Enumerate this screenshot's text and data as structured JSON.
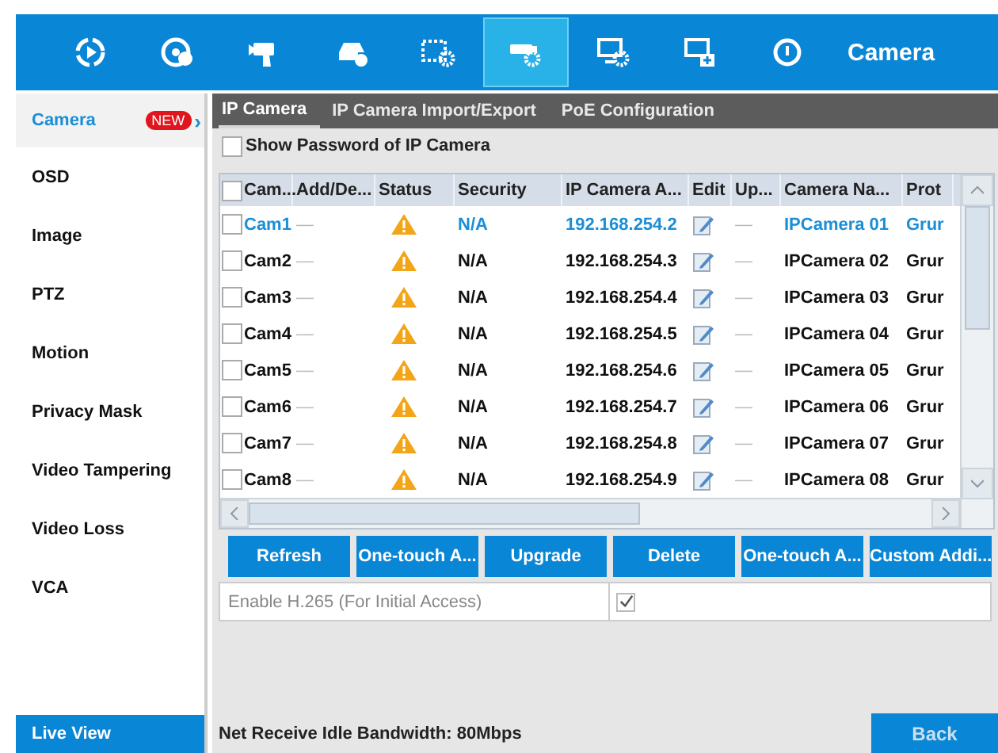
{
  "toolbar": {
    "items": [
      {
        "kind": "playback",
        "selected": false
      },
      {
        "kind": "disc",
        "selected": false
      },
      {
        "kind": "camera-hand",
        "selected": false
      },
      {
        "kind": "storage",
        "selected": false
      },
      {
        "kind": "film-gear",
        "selected": false
      },
      {
        "kind": "camera-gear",
        "selected": true
      },
      {
        "kind": "monitor-gear",
        "selected": false
      },
      {
        "kind": "monitor-plus",
        "selected": false
      },
      {
        "kind": "power",
        "selected": false
      }
    ],
    "title": "Camera"
  },
  "sidebar": {
    "items": [
      {
        "label": "Camera",
        "selected": true,
        "badge": "NEW",
        "arrow": "›"
      },
      {
        "label": "OSD",
        "selected": false
      },
      {
        "label": "Image",
        "selected": false
      },
      {
        "label": "PTZ",
        "selected": false
      },
      {
        "label": "Motion",
        "selected": false
      },
      {
        "label": "Privacy Mask",
        "selected": false
      },
      {
        "label": "Video Tampering",
        "selected": false
      },
      {
        "label": "Video Loss",
        "selected": false
      },
      {
        "label": "VCA",
        "selected": false
      }
    ],
    "footer": "Live View"
  },
  "tabs": [
    {
      "label": "IP Camera",
      "selected": true
    },
    {
      "label": "IP Camera Import/Export",
      "selected": false
    },
    {
      "label": "PoE Configuration",
      "selected": false
    }
  ],
  "show_password": {
    "label": "Show Password of IP Camera",
    "checked": false
  },
  "table": {
    "select_all": {
      "checked": false
    },
    "columns": [
      "Cam...",
      "Add/De...",
      "Status",
      "Security",
      "IP Camera A...",
      "Edit",
      "Up...",
      "Camera Na...",
      "Prot"
    ],
    "rows": [
      {
        "selected": true,
        "checked": false,
        "camera": "Cam1",
        "add": "—",
        "security": "N/A",
        "ip": "192.168.254.2",
        "upgrade": "—",
        "name": "IPCamera 01",
        "protocol": "Grur"
      },
      {
        "selected": false,
        "checked": false,
        "camera": "Cam2",
        "add": "—",
        "security": "N/A",
        "ip": "192.168.254.3",
        "upgrade": "—",
        "name": "IPCamera 02",
        "protocol": "Grur"
      },
      {
        "selected": false,
        "checked": false,
        "camera": "Cam3",
        "add": "—",
        "security": "N/A",
        "ip": "192.168.254.4",
        "upgrade": "—",
        "name": "IPCamera 03",
        "protocol": "Grur"
      },
      {
        "selected": false,
        "checked": false,
        "camera": "Cam4",
        "add": "—",
        "security": "N/A",
        "ip": "192.168.254.5",
        "upgrade": "—",
        "name": "IPCamera 04",
        "protocol": "Grur"
      },
      {
        "selected": false,
        "checked": false,
        "camera": "Cam5",
        "add": "—",
        "security": "N/A",
        "ip": "192.168.254.6",
        "upgrade": "—",
        "name": "IPCamera 05",
        "protocol": "Grur"
      },
      {
        "selected": false,
        "checked": false,
        "camera": "Cam6",
        "add": "—",
        "security": "N/A",
        "ip": "192.168.254.7",
        "upgrade": "—",
        "name": "IPCamera 06",
        "protocol": "Grur"
      },
      {
        "selected": false,
        "checked": false,
        "camera": "Cam7",
        "add": "—",
        "security": "N/A",
        "ip": "192.168.254.8",
        "upgrade": "—",
        "name": "IPCamera 07",
        "protocol": "Grur"
      },
      {
        "selected": false,
        "checked": false,
        "camera": "Cam8",
        "add": "—",
        "security": "N/A",
        "ip": "192.168.254.9",
        "upgrade": "—",
        "name": "IPCamera 08",
        "protocol": "Grur"
      }
    ]
  },
  "buttons": [
    "Refresh",
    "One-touch A...",
    "Upgrade",
    "Delete",
    "One-touch A...",
    "Custom Addi..."
  ],
  "h265": {
    "label": "Enable H.265 (For Initial Access)",
    "checked": true
  },
  "bandwidth": "Net Receive Idle Bandwidth: 80Mbps",
  "back_button": "Back"
}
